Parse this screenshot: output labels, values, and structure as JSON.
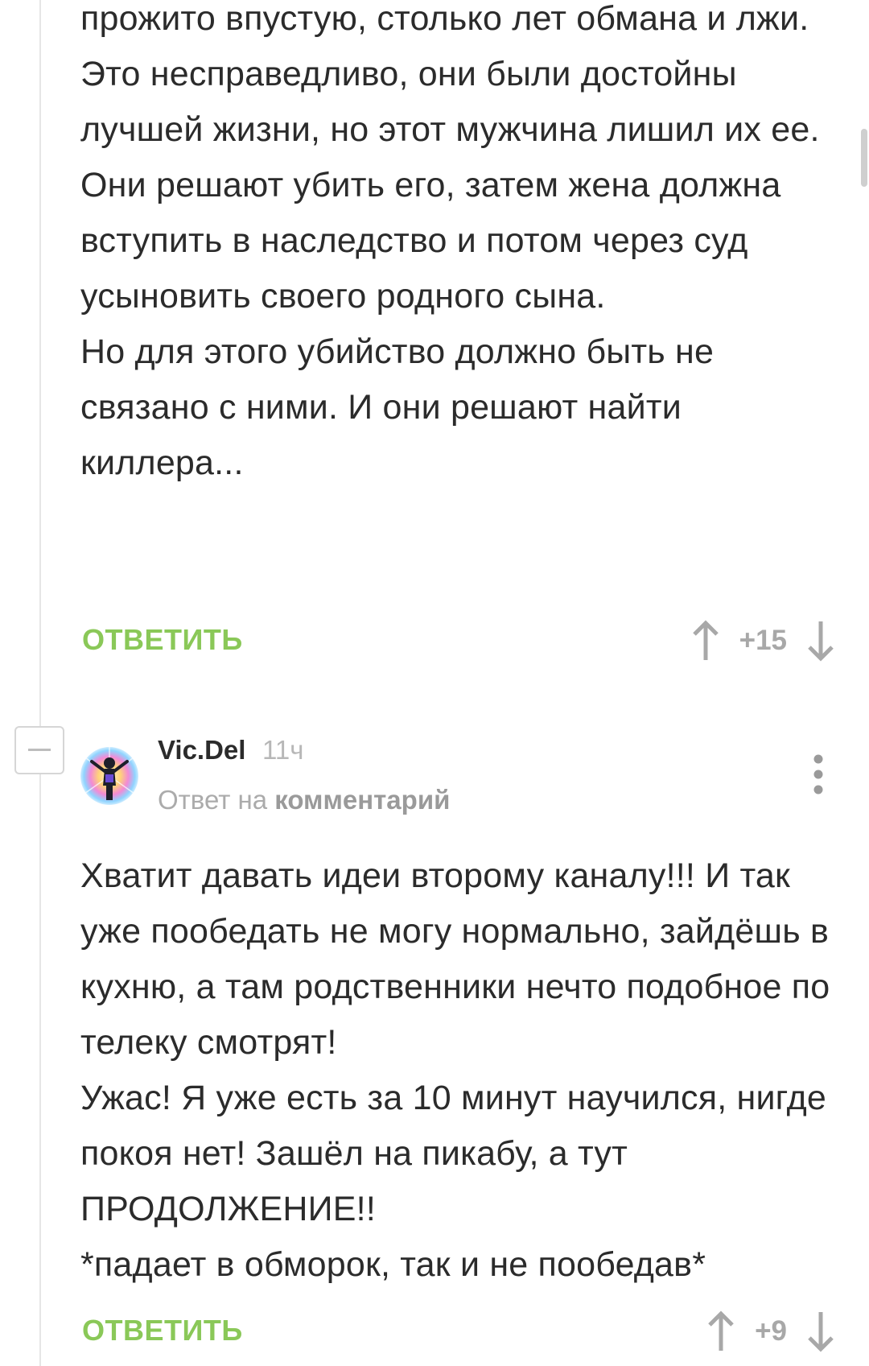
{
  "comment1": {
    "body_lines": [
      "прожито впустую, столько лет обмана и лжи.",
      "Это несправедливо, они были достойны лучшей жизни, но этот мужчина лишил их ее. Они решают убить его, затем жена должна вступить в наследство и потом через суд усыновить своего родного сына.",
      "Но для этого убийство должно быть не связано с ними. И они решают найти киллера..."
    ],
    "reply_label": "ОТВЕТИТЬ",
    "rating": "+15"
  },
  "comment2": {
    "author": "Vic.Del",
    "time": "11ч",
    "reply_prefix": "Ответ на",
    "reply_link": "комментарий",
    "body_lines": [
      "Хватит давать идеи второму каналу!!! И так уже пообедать не могу нормально, зайдёшь в кухню, а там родственники нечто подобное по телеку смотрят!",
      "Ужас! Я уже есть за 10 минут научился, нигде покоя нет! Зашёл на пикабу, а тут ПРОДОЛЖЕНИЕ!!",
      "*падает в обморок, так и не пообедав*"
    ],
    "reply_label": "ОТВЕТИТЬ",
    "rating": "+9"
  },
  "icons": {
    "upvote": "arrow-up-icon",
    "downvote": "arrow-down-icon",
    "collapse": "minus-icon",
    "more": "more-vertical-icon"
  },
  "colors": {
    "accent_green": "#8ac858",
    "text": "#2b2b2b",
    "muted": "#a8a8a8"
  }
}
